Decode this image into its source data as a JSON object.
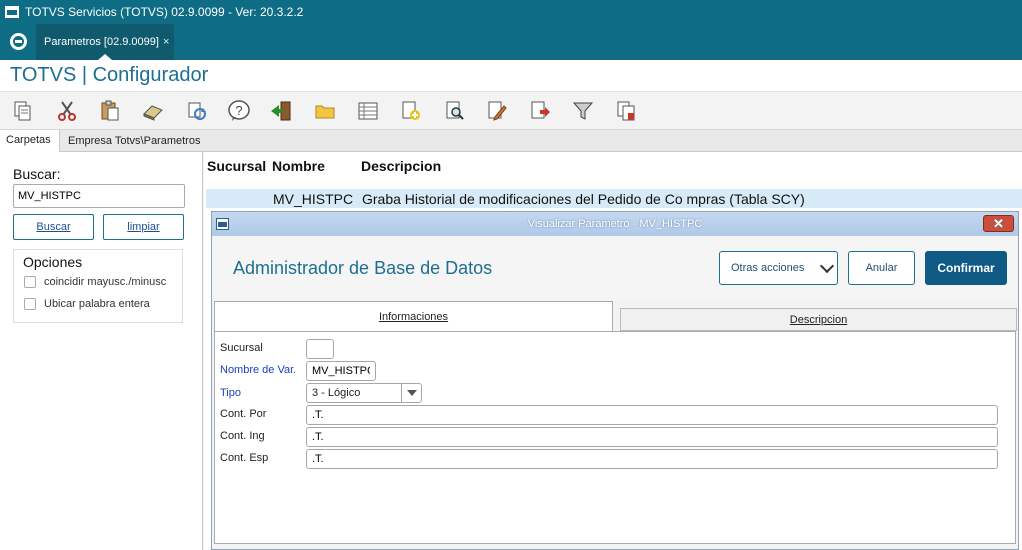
{
  "window": {
    "title": "TOTVS Servicios (TOTVS) 02.9.0099 - Ver: 20.3.2.2"
  },
  "tabbar": {
    "tab_label": "Parametros [02.9.0099]",
    "tab_close": "×"
  },
  "app": {
    "title": "TOTVS | Configurador"
  },
  "toolbar": {
    "icons": [
      "copy-icon",
      "cut-icon",
      "paste-icon",
      "eraser-icon",
      "refresh-icon",
      "help-icon",
      "exit-door-icon",
      "folder-icon",
      "list-view-icon",
      "add-document-icon",
      "search-document-icon",
      "edit-document-icon",
      "export-document-icon",
      "filter-icon",
      "copy-document-icon"
    ]
  },
  "left": {
    "tab_carpetas": "Carpetas",
    "tab_empresa": "Empresa Totvs\\Parametros",
    "search_label": "Buscar:",
    "search_value": "MV_HISTPC",
    "buscar_button": "Buscar",
    "limpiar_button": "limpiar",
    "opciones_title": "Opciones",
    "opt_case": "coincidir mayusc./minusc",
    "opt_whole": "Ubicar palabra entera"
  },
  "grid": {
    "headers": [
      "Sucursal",
      "Nombre",
      "Descripcion"
    ],
    "selected_row": {
      "nombre": "MV_HISTPC",
      "descripcion": "Graba Historial de modificaciones del Pedido de Co mpras (Tabla SCY)"
    }
  },
  "dialog": {
    "title": "Visualizar Parametro - MV_HISTPC",
    "close": "✕",
    "heading": "Administrador de Base de Datos",
    "otras_acciones": "Otras acciones",
    "anular": "Anular",
    "confirmar": "Confirmar",
    "tab_informaciones": "Informaciones",
    "tab_descripcion": "Descripcion",
    "fields": {
      "sucursal_label": "Sucursal",
      "sucursal_value": "",
      "nombre_label": "Nombre de Var.",
      "nombre_value": "MV_HISTPC",
      "tipo_label": "Tipo",
      "tipo_value": "3 - Lógico",
      "cont_por_label": "Cont. Por",
      "cont_por_value": ".T.",
      "cont_ing_label": "Cont. Ing",
      "cont_ing_value": ".T.",
      "cont_esp_label": "Cont. Esp",
      "cont_esp_value": ".T."
    }
  }
}
